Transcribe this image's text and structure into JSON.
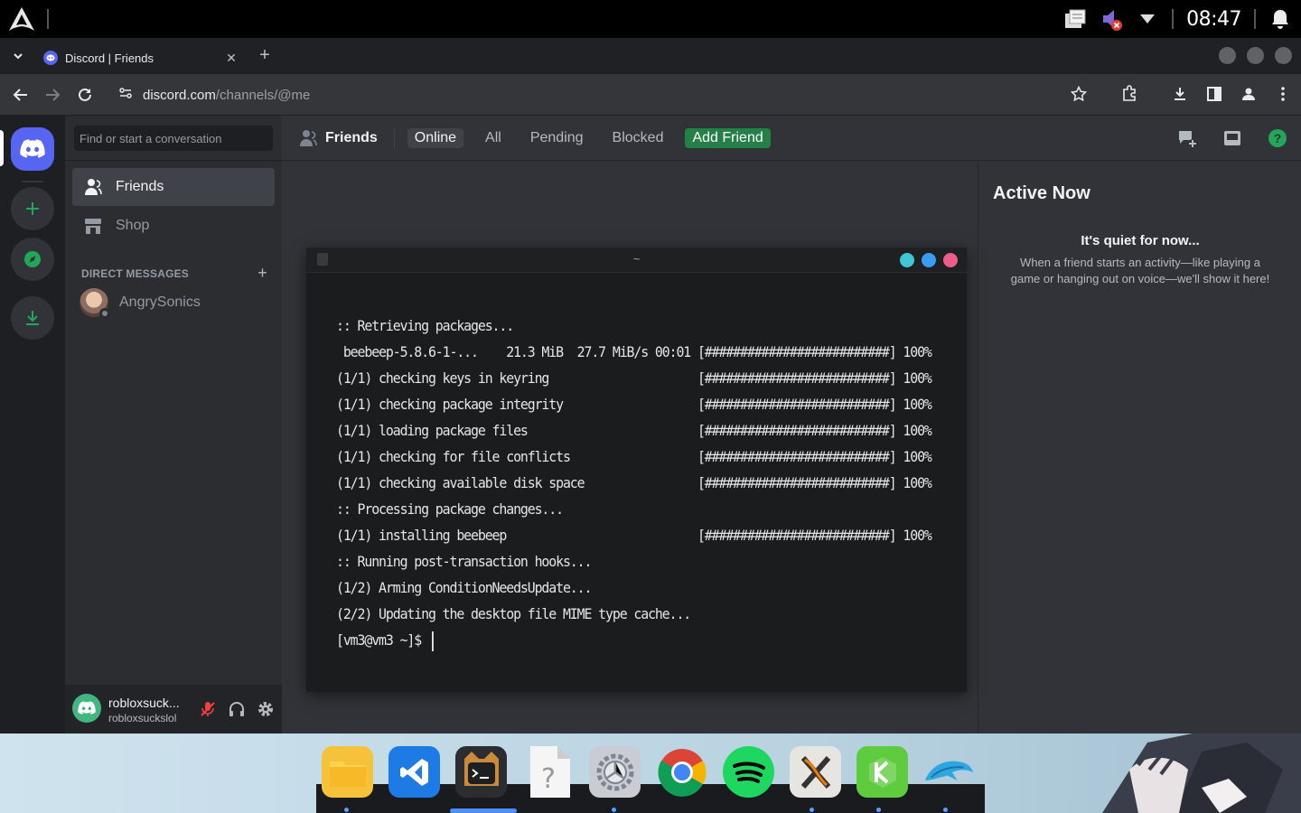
{
  "system": {
    "clock": "08:47"
  },
  "browser": {
    "tab_title": "Discord | Friends",
    "url_host": "discord.com",
    "url_path": "/channels/@me"
  },
  "discord": {
    "search_placeholder": "Find or start a conversation",
    "nav": [
      {
        "label": "Friends",
        "icon": "friends-icon",
        "active": true
      },
      {
        "label": "Shop",
        "icon": "shop-icon",
        "active": false
      }
    ],
    "dm_header": "DIRECT MESSAGES",
    "dm_plus": "+",
    "dms": [
      {
        "name": "AngrySonics",
        "status": "offline"
      }
    ],
    "user": {
      "name": "robloxsuck...",
      "tag": "robloxsuckslol"
    },
    "topbar": {
      "title": "Friends",
      "tabs": [
        "Online",
        "All",
        "Pending",
        "Blocked"
      ],
      "selected_tab": "Online",
      "add_friend": "Add Friend"
    },
    "active_now": {
      "title": "Active Now",
      "quiet": "It's quiet for now...",
      "desc": "When a friend starts an activity—like playing a game or hanging out on voice—we'll show it here!"
    },
    "colors": {
      "brand": "#5865f2",
      "green": "#248046",
      "help": "#23a55a"
    }
  },
  "terminal": {
    "title": "~",
    "lines": [
      ":: Retrieving packages...",
      " beebeep-5.8.6-1-...    21.3 MiB  27.7 MiB/s 00:01 [##########################] 100%",
      "(1/1) checking keys in keyring                     [##########################] 100%",
      "(1/1) checking package integrity                   [##########################] 100%",
      "(1/1) loading package files                        [##########################] 100%",
      "(1/1) checking for file conflicts                  [##########################] 100%",
      "(1/1) checking available disk space                [##########################] 100%",
      ":: Processing package changes...",
      "(1/1) installing beebeep                           [##########################] 100%",
      ":: Running post-transaction hooks...",
      "(1/2) Arming ConditionNeedsUpdate...",
      "(2/2) Updating the desktop file MIME type cache...",
      "[vm3@vm3 ~]$ "
    ],
    "button_colors": [
      "#3fc7d4",
      "#3a9df0",
      "#ef5b8a"
    ]
  },
  "dock": {
    "apps": [
      {
        "name": "files",
        "icon": "folder-icon"
      },
      {
        "name": "vscode",
        "icon": "vscode-icon"
      },
      {
        "name": "terminal",
        "icon": "terminal-icon"
      },
      {
        "name": "unknown",
        "icon": "unknown-file-icon"
      },
      {
        "name": "settings",
        "icon": "settings-icon"
      },
      {
        "name": "chrome",
        "icon": "chrome-icon"
      },
      {
        "name": "spotify",
        "icon": "spotify-icon"
      },
      {
        "name": "xorg",
        "icon": "x-icon"
      },
      {
        "name": "kde-connect",
        "icon": "kde-icon"
      },
      {
        "name": "dolphin",
        "icon": "dolphin-icon"
      }
    ]
  }
}
